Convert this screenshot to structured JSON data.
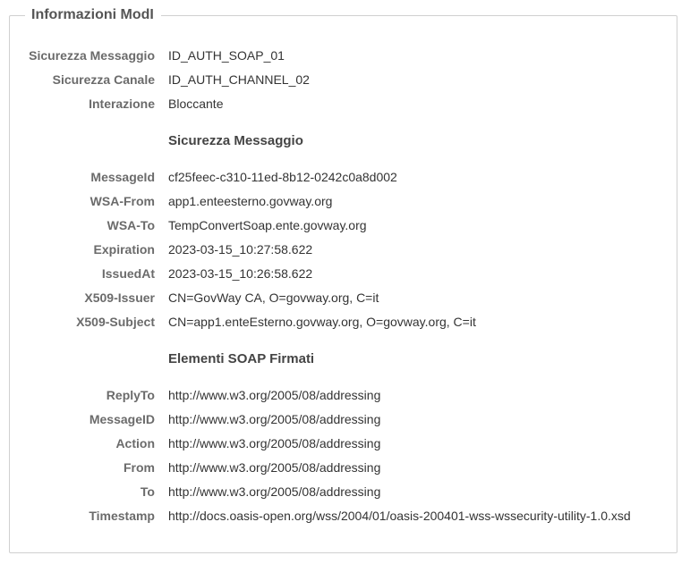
{
  "panel": {
    "title": "Informazioni ModI"
  },
  "general": [
    {
      "label": "Sicurezza Messaggio",
      "value": "ID_AUTH_SOAP_01"
    },
    {
      "label": "Sicurezza Canale",
      "value": "ID_AUTH_CHANNEL_02"
    },
    {
      "label": "Interazione",
      "value": "Bloccante"
    }
  ],
  "security_section": {
    "title": "Sicurezza Messaggio",
    "rows": [
      {
        "label": "MessageId",
        "value": "cf25feec-c310-11ed-8b12-0242c0a8d002"
      },
      {
        "label": "WSA-From",
        "value": "app1.enteesterno.govway.org"
      },
      {
        "label": "WSA-To",
        "value": "TempConvertSoap.ente.govway.org"
      },
      {
        "label": "Expiration",
        "value": "2023-03-15_10:27:58.622"
      },
      {
        "label": "IssuedAt",
        "value": "2023-03-15_10:26:58.622"
      },
      {
        "label": "X509-Issuer",
        "value": "CN=GovWay CA, O=govway.org, C=it"
      },
      {
        "label": "X509-Subject",
        "value": "CN=app1.enteEsterno.govway.org, O=govway.org, C=it"
      }
    ]
  },
  "signed_section": {
    "title": "Elementi SOAP Firmati",
    "rows": [
      {
        "label": "ReplyTo",
        "value": "http://www.w3.org/2005/08/addressing"
      },
      {
        "label": "MessageID",
        "value": "http://www.w3.org/2005/08/addressing"
      },
      {
        "label": "Action",
        "value": "http://www.w3.org/2005/08/addressing"
      },
      {
        "label": "From",
        "value": "http://www.w3.org/2005/08/addressing"
      },
      {
        "label": "To",
        "value": "http://www.w3.org/2005/08/addressing"
      },
      {
        "label": "Timestamp",
        "value": "http://docs.oasis-open.org/wss/2004/01/oasis-200401-wss-wssecurity-utility-1.0.xsd"
      }
    ]
  }
}
